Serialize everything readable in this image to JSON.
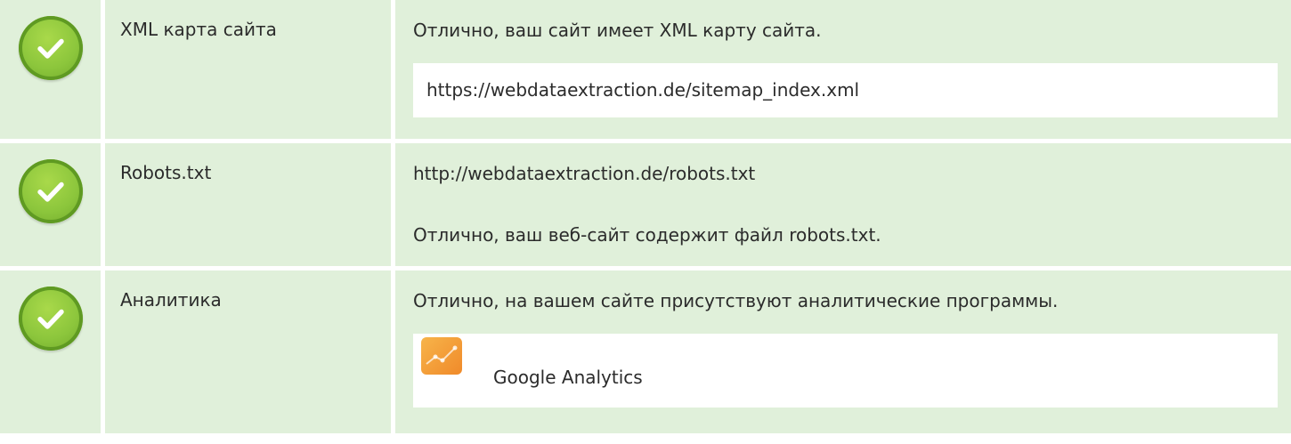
{
  "rows": [
    {
      "status": "passed",
      "label": "XML карта сайта",
      "message": "Отлично, ваш сайт имеет XML карту сайта.",
      "url": "https://webdataextraction.de/sitemap_index.xml"
    },
    {
      "status": "passed",
      "label": "Robots.txt",
      "url": "http://webdataextraction.de/robots.txt",
      "message": "Отлично, ваш веб-сайт содержит файл robots.txt."
    },
    {
      "status": "passed",
      "label": "Аналитика",
      "message": "Отлично, на вашем сайте присутствуют аналитические программы.",
      "tools": [
        {
          "icon": "google-analytics-icon",
          "name": "Google Analytics"
        }
      ]
    }
  ],
  "colors": {
    "row_background": "#e0f0da",
    "check_green": "#8cc63c",
    "analytics_orange": "#f08a2a"
  }
}
